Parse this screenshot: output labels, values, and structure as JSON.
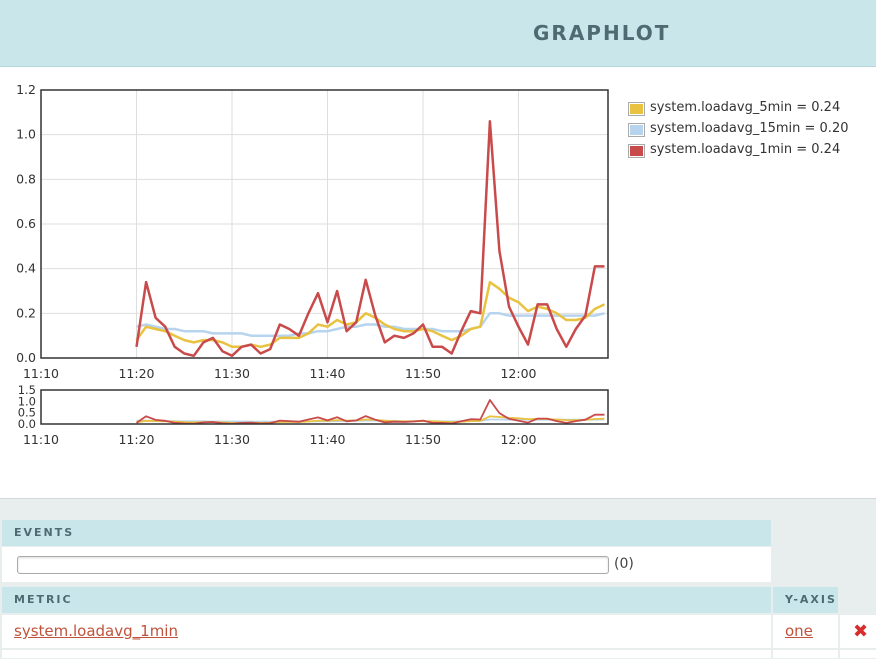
{
  "app": {
    "title": "GRAPHLOT"
  },
  "chart_data": [
    {
      "type": "line",
      "x_unit": "time (HH:MM)",
      "x_ticks": [
        "11:10",
        "11:20",
        "11:30",
        "11:40",
        "11:50",
        "12:00"
      ],
      "ylim": [
        0,
        1.2
      ],
      "y_ticks": [
        "0.0",
        "0.2",
        "0.4",
        "0.6",
        "0.8",
        "1.0",
        "1.2"
      ],
      "grid": true,
      "legend_position": "right",
      "series": [
        {
          "name": "system.loadavg_15min",
          "color": "#b6d4ee",
          "x": [
            "11:20",
            "11:21",
            "11:22",
            "11:23",
            "11:24",
            "11:25",
            "11:26",
            "11:27",
            "11:28",
            "11:29",
            "11:30",
            "11:31",
            "11:32",
            "11:33",
            "11:34",
            "11:35",
            "11:36",
            "11:37",
            "11:38",
            "11:39",
            "11:40",
            "11:41",
            "11:42",
            "11:43",
            "11:44",
            "11:45",
            "11:46",
            "11:47",
            "11:48",
            "11:49",
            "11:50",
            "11:51",
            "11:52",
            "11:53",
            "11:54",
            "11:55",
            "11:56",
            "11:57",
            "11:58",
            "11:59",
            "12:00",
            "12:01",
            "12:02",
            "12:03",
            "12:04",
            "12:05",
            "12:06",
            "12:07",
            "12:08",
            "12:09"
          ],
          "y": [
            0.14,
            0.15,
            0.14,
            0.13,
            0.13,
            0.12,
            0.12,
            0.12,
            0.11,
            0.11,
            0.11,
            0.11,
            0.1,
            0.1,
            0.1,
            0.1,
            0.1,
            0.11,
            0.11,
            0.12,
            0.12,
            0.13,
            0.14,
            0.14,
            0.15,
            0.15,
            0.14,
            0.14,
            0.13,
            0.13,
            0.13,
            0.13,
            0.12,
            0.12,
            0.12,
            0.13,
            0.14,
            0.2,
            0.2,
            0.19,
            0.19,
            0.19,
            0.19,
            0.19,
            0.19,
            0.19,
            0.19,
            0.19,
            0.19,
            0.2
          ]
        },
        {
          "name": "system.loadavg_5min",
          "color": "#e8c240",
          "x": [
            "11:20",
            "11:21",
            "11:22",
            "11:23",
            "11:24",
            "11:25",
            "11:26",
            "11:27",
            "11:28",
            "11:29",
            "11:30",
            "11:31",
            "11:32",
            "11:33",
            "11:34",
            "11:35",
            "11:36",
            "11:37",
            "11:38",
            "11:39",
            "11:40",
            "11:41",
            "11:42",
            "11:43",
            "11:44",
            "11:45",
            "11:46",
            "11:47",
            "11:48",
            "11:49",
            "11:50",
            "11:51",
            "11:52",
            "11:53",
            "11:54",
            "11:55",
            "11:56",
            "11:57",
            "11:58",
            "11:59",
            "12:00",
            "12:01",
            "12:02",
            "12:03",
            "12:04",
            "12:05",
            "12:06",
            "12:07",
            "12:08",
            "12:09"
          ],
          "y": [
            0.08,
            0.14,
            0.13,
            0.12,
            0.1,
            0.08,
            0.07,
            0.08,
            0.08,
            0.07,
            0.05,
            0.05,
            0.06,
            0.05,
            0.06,
            0.09,
            0.09,
            0.09,
            0.11,
            0.15,
            0.14,
            0.17,
            0.15,
            0.16,
            0.2,
            0.18,
            0.15,
            0.13,
            0.12,
            0.12,
            0.13,
            0.12,
            0.1,
            0.08,
            0.1,
            0.13,
            0.14,
            0.34,
            0.31,
            0.27,
            0.25,
            0.21,
            0.23,
            0.22,
            0.2,
            0.17,
            0.17,
            0.18,
            0.22,
            0.24
          ]
        },
        {
          "name": "system.loadavg_1min",
          "color": "#c94a4a",
          "x": [
            "11:20",
            "11:21",
            "11:22",
            "11:23",
            "11:24",
            "11:25",
            "11:26",
            "11:27",
            "11:28",
            "11:29",
            "11:30",
            "11:31",
            "11:32",
            "11:33",
            "11:34",
            "11:35",
            "11:36",
            "11:37",
            "11:38",
            "11:39",
            "11:40",
            "11:41",
            "11:42",
            "11:43",
            "11:44",
            "11:45",
            "11:46",
            "11:47",
            "11:48",
            "11:49",
            "11:50",
            "11:51",
            "11:52",
            "11:53",
            "11:54",
            "11:55",
            "11:56",
            "11:57",
            "11:58",
            "11:59",
            "12:00",
            "12:01",
            "12:02",
            "12:03",
            "12:04",
            "12:05",
            "12:06",
            "12:07",
            "12:08",
            "12:09"
          ],
          "y": [
            0.05,
            0.34,
            0.18,
            0.14,
            0.05,
            0.02,
            0.01,
            0.07,
            0.09,
            0.03,
            0.01,
            0.05,
            0.06,
            0.02,
            0.04,
            0.15,
            0.13,
            0.1,
            0.2,
            0.29,
            0.16,
            0.3,
            0.12,
            0.16,
            0.35,
            0.19,
            0.07,
            0.1,
            0.09,
            0.11,
            0.15,
            0.05,
            0.05,
            0.02,
            0.12,
            0.21,
            0.2,
            1.06,
            0.48,
            0.23,
            0.14,
            0.06,
            0.24,
            0.24,
            0.13,
            0.05,
            0.13,
            0.19,
            0.41,
            0.41
          ]
        }
      ]
    },
    {
      "type": "line",
      "role": "overview",
      "x_ticks": [
        "11:10",
        "11:20",
        "11:30",
        "11:40",
        "11:50",
        "12:00"
      ],
      "ylim": [
        0,
        1.5
      ],
      "y_ticks": [
        "0.0",
        "0.5",
        "1.0",
        "1.5"
      ]
    }
  ],
  "legend": [
    {
      "label": "system.loadavg_5min = 0.24",
      "color": "#e8c240"
    },
    {
      "label": "system.loadavg_15min = 0.20",
      "color": "#b6d4ee"
    },
    {
      "label": "system.loadavg_1min = 0.24",
      "color": "#c94a4a"
    }
  ],
  "events": {
    "header": "EVENTS",
    "count": "(0)",
    "input_value": ""
  },
  "metrics": {
    "header_metric": "METRIC",
    "header_yaxis": "Y-AXIS",
    "rows": [
      {
        "metric": "system.loadavg_1min",
        "yaxis": "one",
        "remove": "✖"
      }
    ]
  }
}
